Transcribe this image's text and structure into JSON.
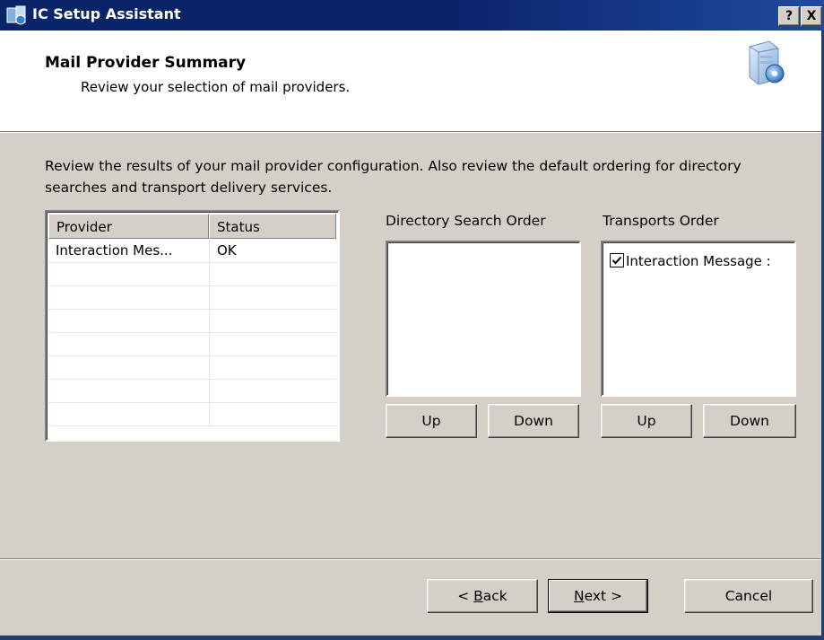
{
  "window": {
    "title": "IC Setup Assistant",
    "help_button": "?",
    "close_button": "X"
  },
  "header": {
    "title": "Mail Provider Summary",
    "subtitle": "Review your selection of mail providers."
  },
  "intro": {
    "text": "Review the results of your mail provider configuration. Also review the default ordering for directory searches and transport delivery services."
  },
  "providers": {
    "columns": [
      "Provider",
      "Status"
    ],
    "rows": [
      {
        "provider": "Interaction Mes...",
        "status": "OK"
      }
    ]
  },
  "directory_search": {
    "label": "Directory Search Order",
    "up_label": "Up",
    "down_label": "Down"
  },
  "transports": {
    "label": "Transports Order",
    "items": [
      {
        "label": "Interaction Message :",
        "checked": true
      }
    ],
    "up_label": "Up",
    "down_label": "Down"
  },
  "footer": {
    "back_prefix": "< ",
    "back_mnemonic": "B",
    "back_rest": "ack",
    "next_mnemonic": "N",
    "next_rest": "ext >",
    "cancel_label": "Cancel"
  },
  "colors": {
    "titlebar": "#0a246a",
    "dialog_bg": "#d4d0c8",
    "header_bg": "#ffffff"
  }
}
